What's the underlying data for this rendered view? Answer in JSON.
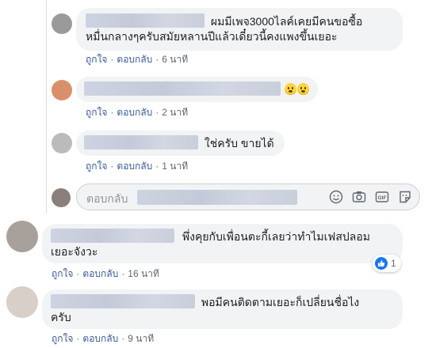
{
  "comments": [
    {
      "text": "ผมมีเพจ3000ไลค์เคยมีคนขอซื้อหมื่นกลางๆครับสมัยหลานปีแล้วเดี๋ยวนี้คงแพงขึ้นเยอะ",
      "line1": "ผมมีเพจ3000ไลค์เคยมีคนขอซื้อ",
      "line2": "หมื่นกลางๆครับสมัยหลานปีแล้วเดี๋ยวนี้คงแพงขึ้นเยอะ",
      "like": "ถูกใจ",
      "reply": "ตอบกลับ",
      "time": "6 นาที",
      "avatar_color": "#9a9a9a"
    },
    {
      "text": "",
      "emoji": [
        "smiling-face",
        "smiling-face"
      ],
      "like": "ถูกใจ",
      "reply": "ตอบกลับ",
      "time": "2 นาที",
      "avatar_color": "#d9906a"
    },
    {
      "text": "ใช่ครับ ขายได้",
      "like": "ถูกใจ",
      "reply": "ตอบกลับ",
      "time": "1 นาที",
      "avatar_color": "#b9bcb8"
    },
    {
      "text": "พึ่งคุยกับเพื่อนตะกี้เลยว่าทำไมเฟสปลอมเยอะจังวะ",
      "line1": "พึ่งคุยกับเพื่อนตะกี้เลยว่าทำไมเฟสปลอม",
      "line2": "เยอะจังวะ",
      "like": "ถูกใจ",
      "reply": "ตอบกลับ",
      "time": "16 นาที",
      "reaction_count": "1",
      "avatar_color": "#a8a09a"
    },
    {
      "text": "พอมีคนติดตามเยอะก็เปลี่ยนชื่อไงครับ",
      "line1": "พอมีคนติดตามเยอะก็เปลี่ยนชื่อไง",
      "line2": "ครับ",
      "like": "ถูกใจ",
      "reply": "ตอบกลับ",
      "time": "9 นาที",
      "avatar_color": "#d8cfc9"
    }
  ],
  "reply_box": {
    "placeholder": "ตอบกลับ",
    "icons": [
      "emoji-icon",
      "camera-icon",
      "gif-icon",
      "sticker-icon"
    ],
    "avatar_color": "#8a7f7b"
  },
  "colors": {
    "link": "#385898",
    "bubble": "#f2f3f5",
    "like_blue": "#1877f2"
  }
}
